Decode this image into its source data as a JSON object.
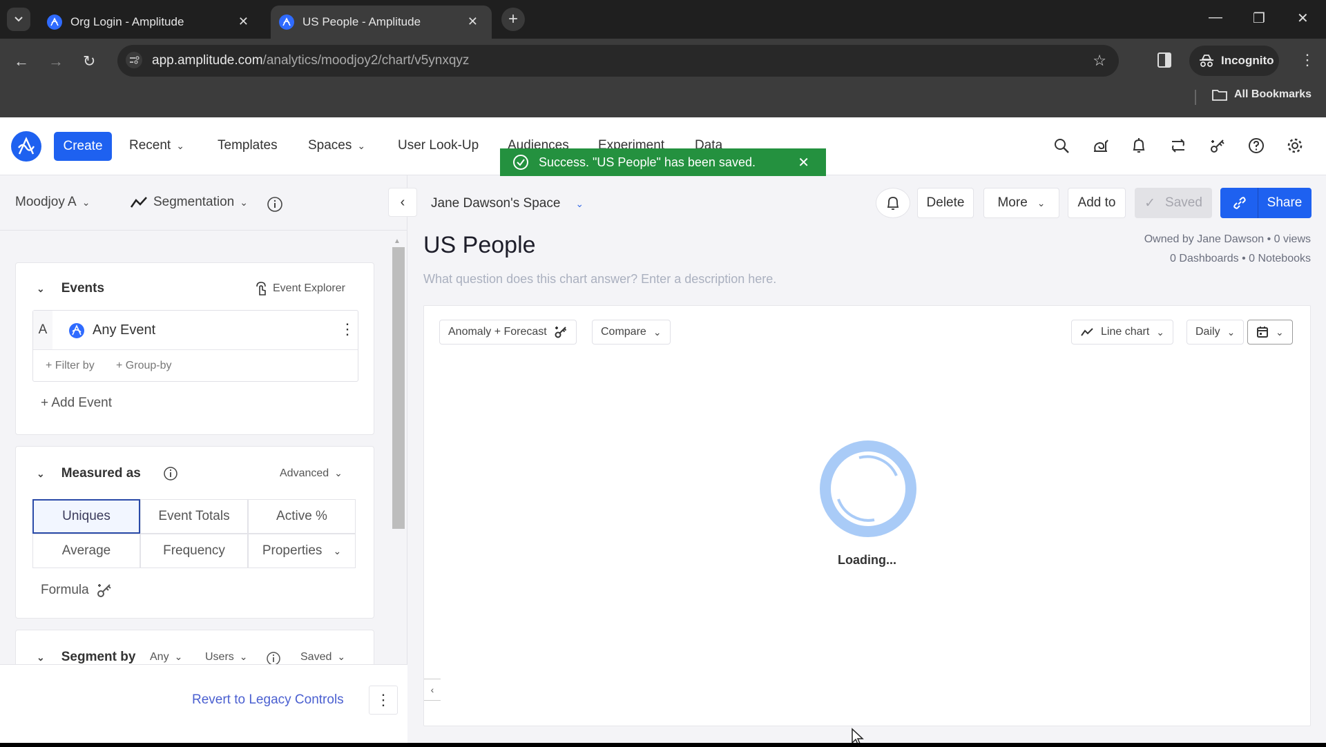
{
  "browser": {
    "tabs": [
      {
        "title": "Org Login - Amplitude",
        "active": false
      },
      {
        "title": "US People - Amplitude",
        "active": true
      }
    ],
    "url": {
      "host": "app.amplitude.com",
      "path": "/analytics/moodjoy2/chart/v5ynxqyz"
    },
    "incognito_label": "Incognito",
    "bookmarks_label": "All Bookmarks"
  },
  "topnav": {
    "create_label": "Create",
    "items": [
      {
        "label": "Recent",
        "dropdown": true
      },
      {
        "label": "Templates",
        "dropdown": false
      },
      {
        "label": "Spaces",
        "dropdown": true
      },
      {
        "label": "User Look-Up",
        "dropdown": false
      },
      {
        "label": "Audiences",
        "dropdown": false
      },
      {
        "label": "Experiment",
        "dropdown": false
      },
      {
        "label": "Data",
        "dropdown": false
      }
    ],
    "icons": [
      "search-icon",
      "snail-icon",
      "bell-icon",
      "sync-icon",
      "formula-key-icon",
      "help-icon",
      "gear-icon"
    ]
  },
  "toast": {
    "message": "Success. \"US People\" has been saved.",
    "color": "#24913f"
  },
  "left_panel": {
    "project": "Moodjoy A",
    "chart_type": "Segmentation",
    "events": {
      "title": "Events",
      "explorer_label": "Event Explorer",
      "event_letter": "A",
      "event_name": "Any Event",
      "filter_label": "+ Filter by",
      "groupby_label": "+ Group-by",
      "add_event_label": "+ Add Event"
    },
    "measured_as": {
      "title": "Measured as",
      "advanced_label": "Advanced",
      "options": [
        "Uniques",
        "Event Totals",
        "Active %",
        "Average",
        "Frequency",
        "Properties"
      ],
      "selected": "Uniques",
      "formula_label": "Formula"
    },
    "segment_by": {
      "title": "Segment by",
      "any_label": "Any",
      "users_label": "Users",
      "saved_label": "Saved"
    },
    "revert_label": "Revert to Legacy Controls"
  },
  "main": {
    "space": "Jane Dawson's Space",
    "title": "US People",
    "description_placeholder": "What question does this chart answer? Enter a description here.",
    "actions": {
      "delete": "Delete",
      "more": "More",
      "add_to": "Add to",
      "saved": "Saved",
      "share": "Share"
    },
    "meta_line1": "Owned by Jane Dawson • 0 views",
    "meta_line2": "0 Dashboards • 0 Notebooks",
    "chart_controls": {
      "anomaly": "Anomaly + Forecast",
      "compare": "Compare",
      "chart_type": "Line chart",
      "interval": "Daily"
    },
    "loading_text": "Loading..."
  },
  "colors": {
    "brand": "#1e61f0",
    "link": "#4a5fd0",
    "spinner": "#a9cbf7"
  }
}
